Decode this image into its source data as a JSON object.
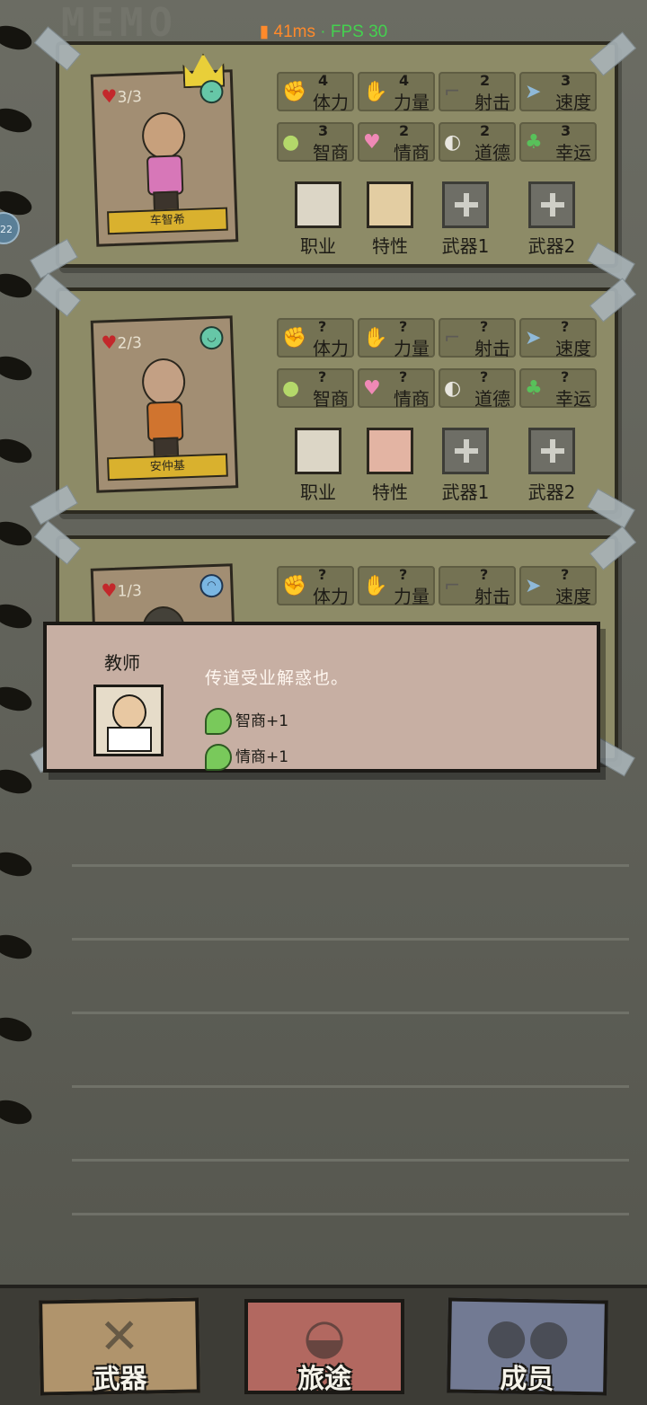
{
  "perf": {
    "latency": "41ms",
    "separator": "·",
    "fps": "FPS 30"
  },
  "memo_title": "MEMO",
  "side_badge": "22",
  "colors": {
    "latency": "#ff8a2b",
    "fps": "#44d14f",
    "nameplate": "#d9b12e"
  },
  "stat_labels": [
    "体力",
    "力量",
    "射击",
    "速度",
    "智商",
    "情商",
    "道德",
    "幸运"
  ],
  "stat_icons": [
    "muscle-icon",
    "arm-icon",
    "gun-icon",
    "boot-icon",
    "brain-icon",
    "heart-icon",
    "mask-icon",
    "clover-icon"
  ],
  "slot_labels": {
    "job": "职业",
    "trait": "特性",
    "weapon1": "武器1",
    "weapon2": "武器2"
  },
  "characters": [
    {
      "hp": "3/3",
      "name": "车智希",
      "mood": "neutral",
      "crown": true,
      "stats": [
        "4",
        "4",
        "2",
        "3",
        "3",
        "2",
        "2",
        "3"
      ]
    },
    {
      "hp": "2/3",
      "name": "安仲基",
      "mood": "happy",
      "crown": false,
      "stats": [
        "?",
        "?",
        "?",
        "?",
        "?",
        "?",
        "?",
        "?"
      ]
    },
    {
      "hp": "1/3",
      "name": "",
      "mood": "sad",
      "crown": false,
      "stats": [
        "?",
        "?",
        "?",
        "?",
        "?",
        "?",
        "?",
        "?"
      ]
    }
  ],
  "popup": {
    "job_name": "教师",
    "description": "传道受业解惑也。",
    "bonuses": [
      "智商+1",
      "情商+1"
    ]
  },
  "tabs": [
    {
      "label": "武器",
      "icon": "guns-icon",
      "color": "#b0946c"
    },
    {
      "label": "旅途",
      "icon": "car-icon",
      "color": "#b26860"
    },
    {
      "label": "成员",
      "icon": "people-icon",
      "color": "#727a93"
    }
  ]
}
